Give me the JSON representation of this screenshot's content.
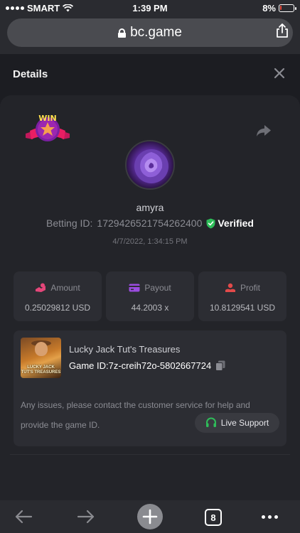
{
  "status_bar": {
    "carrier": "SMART",
    "time": "1:39 PM",
    "battery": "8%",
    "battery_level": 0.08
  },
  "browser": {
    "url": "bc.game",
    "tab_count": "8"
  },
  "details": {
    "title": "Details",
    "badge": "WIN",
    "username": "amyra",
    "betting_id_label": "Betting ID:",
    "betting_id": "1729426521754262400",
    "verified_label": "Verified",
    "datetime": "4/7/2022, 1:34:15 PM"
  },
  "stats": [
    {
      "label": "Amount",
      "value": "0.25029812 USD",
      "icon": "money-icon",
      "color": "#e5467a"
    },
    {
      "label": "Payout",
      "value": "44.2003 x",
      "icon": "card-icon",
      "color": "#9b4ce0"
    },
    {
      "label": "Profit",
      "value": "10.8129541 USD",
      "icon": "profit-icon",
      "color": "#e24a4a"
    }
  ],
  "game": {
    "name": "Lucky Jack Tut's Treasures",
    "id_label": "Game ID:",
    "id": "7z-creih72o-5802667724",
    "thumb_text_1": "LUCKY JACK",
    "thumb_text_2": "TUT'S TREASURES",
    "help_text": "Any issues, please contact the customer service for help and provide the game ID.",
    "support_label": "Live Support"
  },
  "colors": {
    "accent_green": "#2ebd59",
    "background": "#1c1d22",
    "card": "#232429",
    "panel": "#2c2d33"
  }
}
